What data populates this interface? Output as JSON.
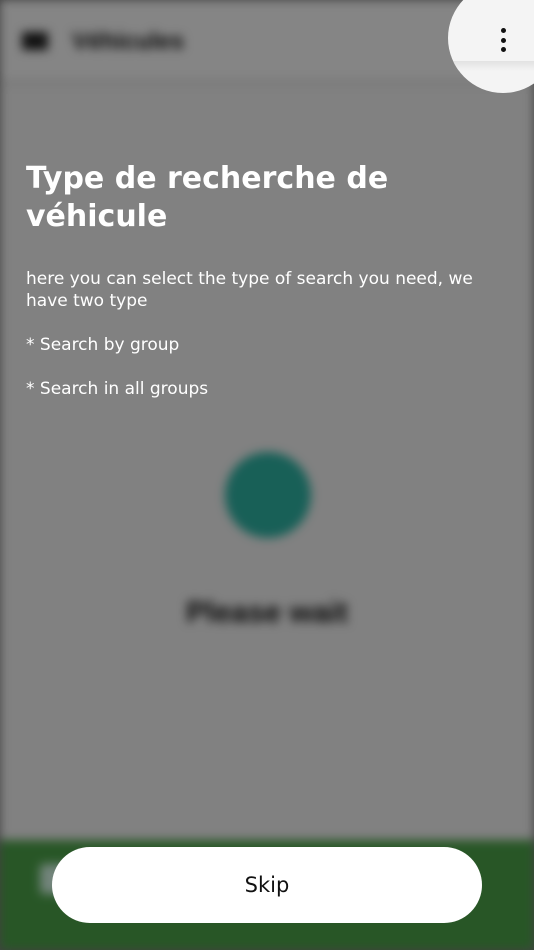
{
  "background": {
    "header_title": "Véhicules",
    "wait_text": "Please wait",
    "spinner_color": "#2fb8a8",
    "footer_color": "#4da64a"
  },
  "tour": {
    "title": "Type de recherche de véhicule",
    "description": "here you can select the type of search you need, we have two type",
    "options": [
      "* Search by group",
      "* Search in all groups"
    ],
    "highlighted_icon": "more-vertical-icon"
  },
  "skip": {
    "label": "Skip"
  },
  "colors": {
    "overlay": "#7f7f7f",
    "text": "#ffffff",
    "button_bg": "#ffffff"
  }
}
